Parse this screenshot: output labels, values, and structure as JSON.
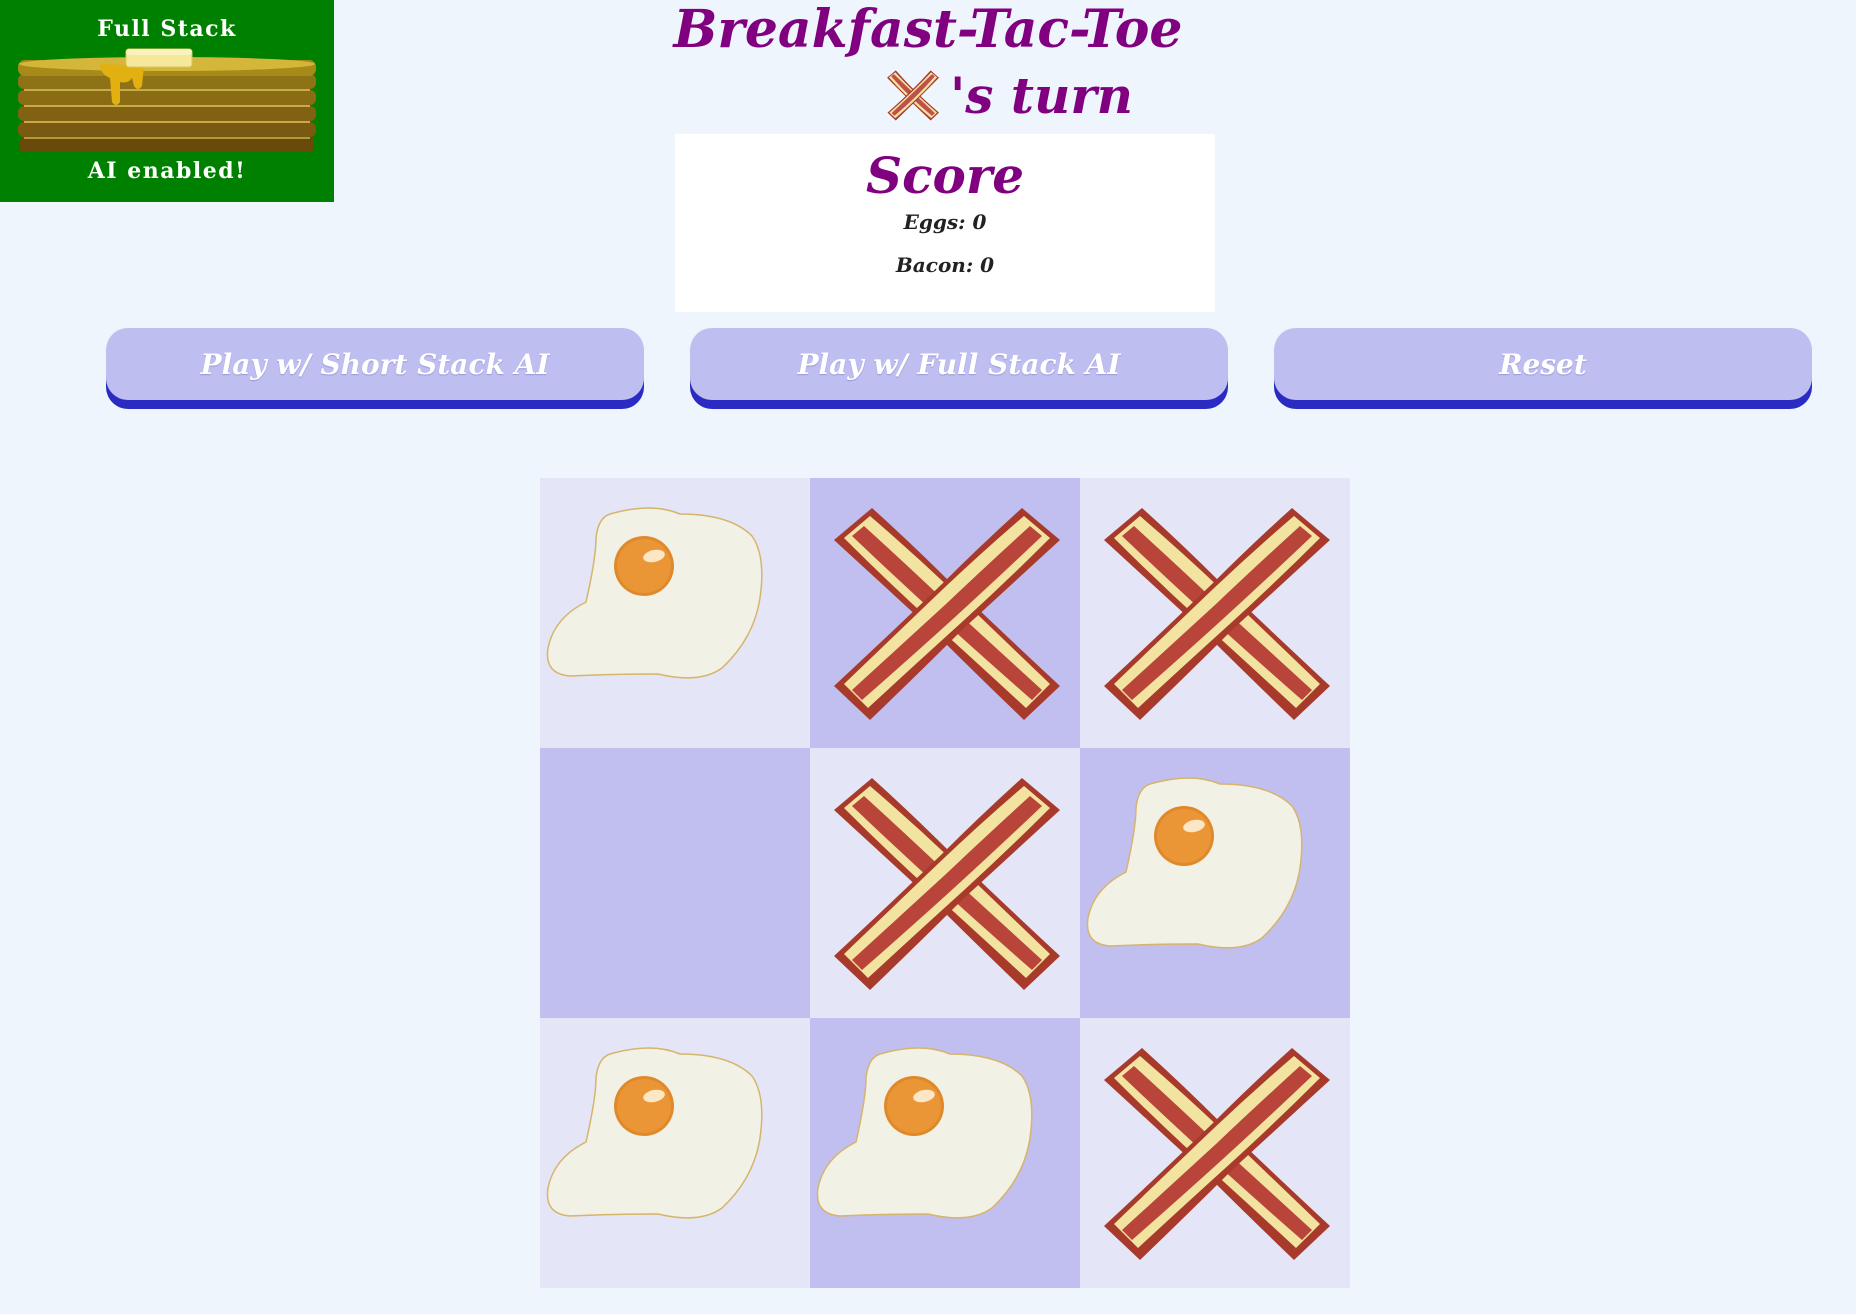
{
  "ai_badge": {
    "title": "Full Stack",
    "status": "AI enabled!",
    "color": "#008000",
    "icon": "pancake-stack-icon"
  },
  "header": {
    "title": "Breakfast-Tac-Toe",
    "turn_piece": "bacon",
    "turn_text": "'s turn"
  },
  "score": {
    "heading": "Score",
    "eggs_text": "Eggs: 0",
    "bacon_text": "Bacon: 0",
    "eggs": 0,
    "bacon": 0
  },
  "buttons": {
    "short_stack": "Play w/ Short Stack AI",
    "full_stack": "Play w/ Full Stack AI",
    "reset": "Reset"
  },
  "board": {
    "cells": [
      "egg",
      "bacon",
      "bacon",
      "",
      "bacon",
      "egg",
      "egg",
      "egg",
      "bacon"
    ]
  },
  "colors": {
    "title": "#800080",
    "page_background": "#eef5fd",
    "cell_light": "#e5e5f8",
    "cell_dark": "#c0bff0",
    "button": "#bfbef0",
    "button_shadow": "#2b2bc4"
  }
}
